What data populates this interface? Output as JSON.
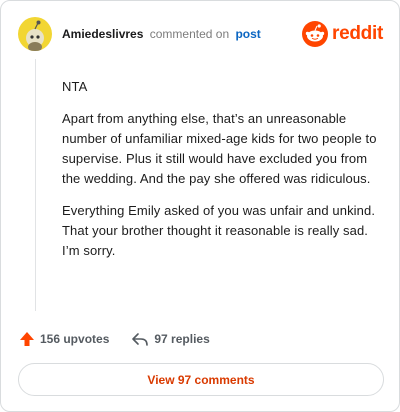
{
  "header": {
    "username": "Amiedeslivres",
    "verb": "commented on",
    "link_text": "post",
    "brand": "reddit",
    "brand_color": "#ff4500",
    "avatar_color": "#f2d633"
  },
  "comment": {
    "paragraphs": [
      "NTA",
      "Apart from anything else, that’s an unreasonable number of unfamiliar mixed-age kids for two people to supervise. Plus it still would have excluded you from the wedding. And the pay she offered was ridiculous.",
      "Everything Emily asked of you was unfair and unkind. That your brother thought it reasonable is really sad. I’m sorry."
    ]
  },
  "actions": {
    "upvotes": "156 upvotes",
    "replies": "97 replies",
    "upvote_icon": "upvote-arrow-icon",
    "reply_icon": "reply-arrow-icon"
  },
  "footer": {
    "view_comments": "View 97 comments",
    "accent": "#d93a00"
  }
}
